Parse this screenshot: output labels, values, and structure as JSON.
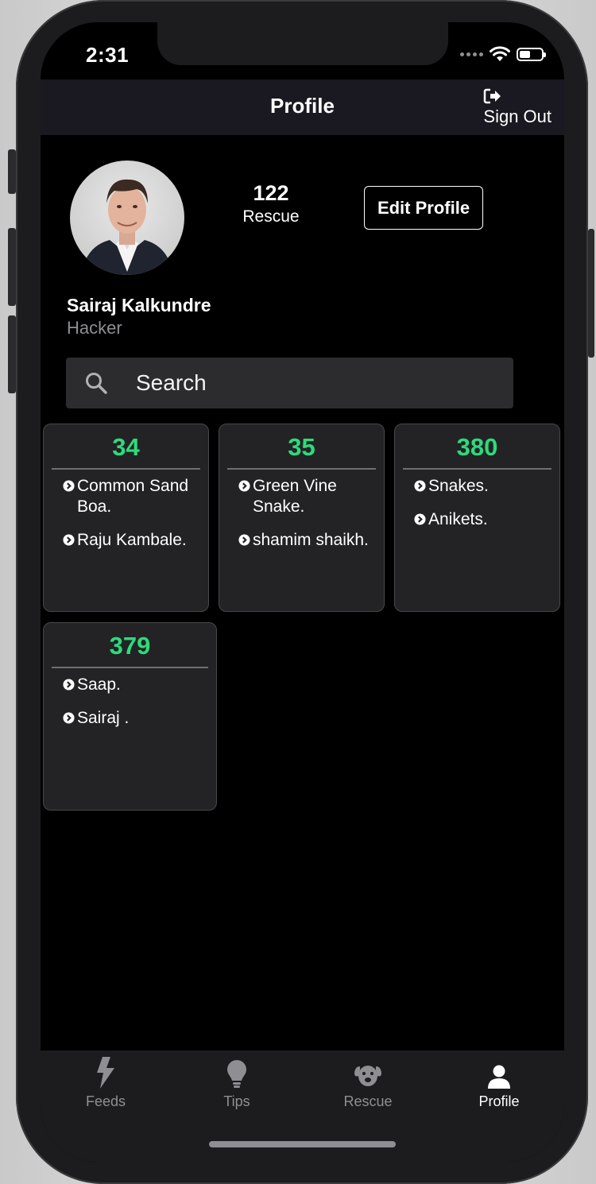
{
  "status_bar": {
    "time": "2:31"
  },
  "header": {
    "title": "Profile",
    "sign_out_label": "Sign Out"
  },
  "profile": {
    "stat_value": "122",
    "stat_label": "Rescue",
    "edit_button_label": "Edit Profile",
    "name": "Sairaj Kalkundre",
    "role": "Hacker"
  },
  "search": {
    "placeholder": "Search"
  },
  "cards": [
    {
      "number": "34",
      "items": [
        "Common Sand Boa.",
        "Raju Kambale."
      ]
    },
    {
      "number": "35",
      "items": [
        "Green Vine Snake.",
        "shamim shaikh."
      ]
    },
    {
      "number": "380",
      "items": [
        "Snakes.",
        "Anikets."
      ]
    },
    {
      "number": "379",
      "items": [
        "Saap.",
        "Sairaj ."
      ]
    }
  ],
  "tabbar": {
    "tabs": [
      {
        "label": "Feeds",
        "icon": "bolt-icon"
      },
      {
        "label": "Tips",
        "icon": "lightbulb-icon"
      },
      {
        "label": "Rescue",
        "icon": "dog-icon"
      },
      {
        "label": "Profile",
        "icon": "user-icon"
      }
    ],
    "active": "Profile"
  },
  "colors": {
    "accent_green": "#2ddb7b",
    "navbar_bg": "#1a1820",
    "card_bg": "#232325"
  }
}
